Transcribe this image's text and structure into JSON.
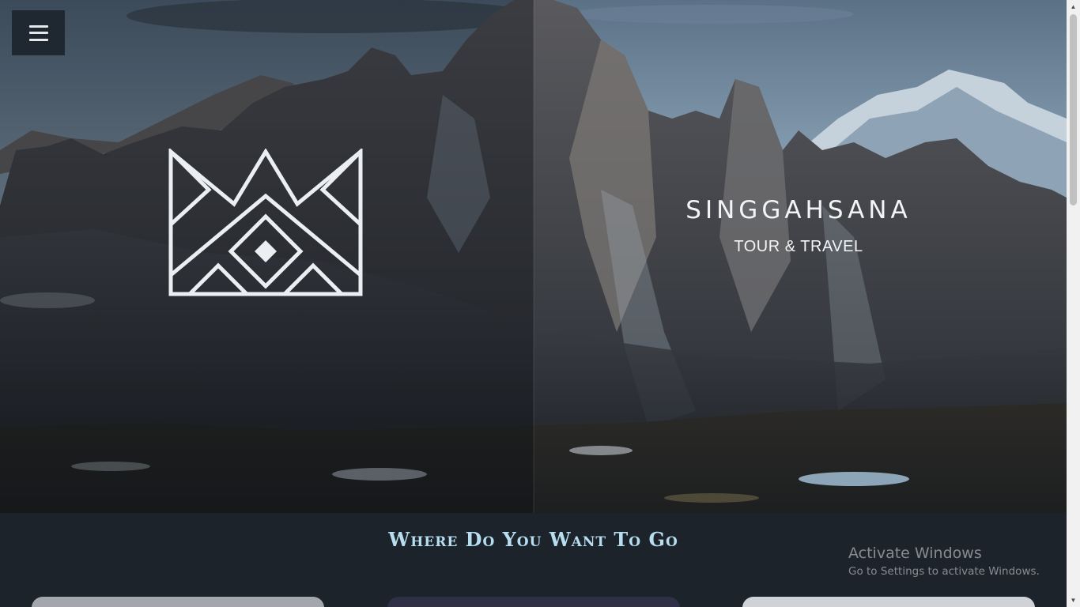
{
  "hero": {
    "menu_icon": "hamburger-menu-icon",
    "logo_icon": "crown-triangle-logo",
    "brand_name": "SINGGAHSANA",
    "brand_tagline": "TOUR & TRAVEL"
  },
  "destinations": {
    "title": "Where Do You Want To Go"
  },
  "watermark": {
    "line1": "Activate Windows",
    "line2": "Go to Settings to activate Windows."
  },
  "colors": {
    "title_accent": "#b6def0",
    "section_bg": "#1c232a",
    "menu_bg": "#1f2830"
  }
}
